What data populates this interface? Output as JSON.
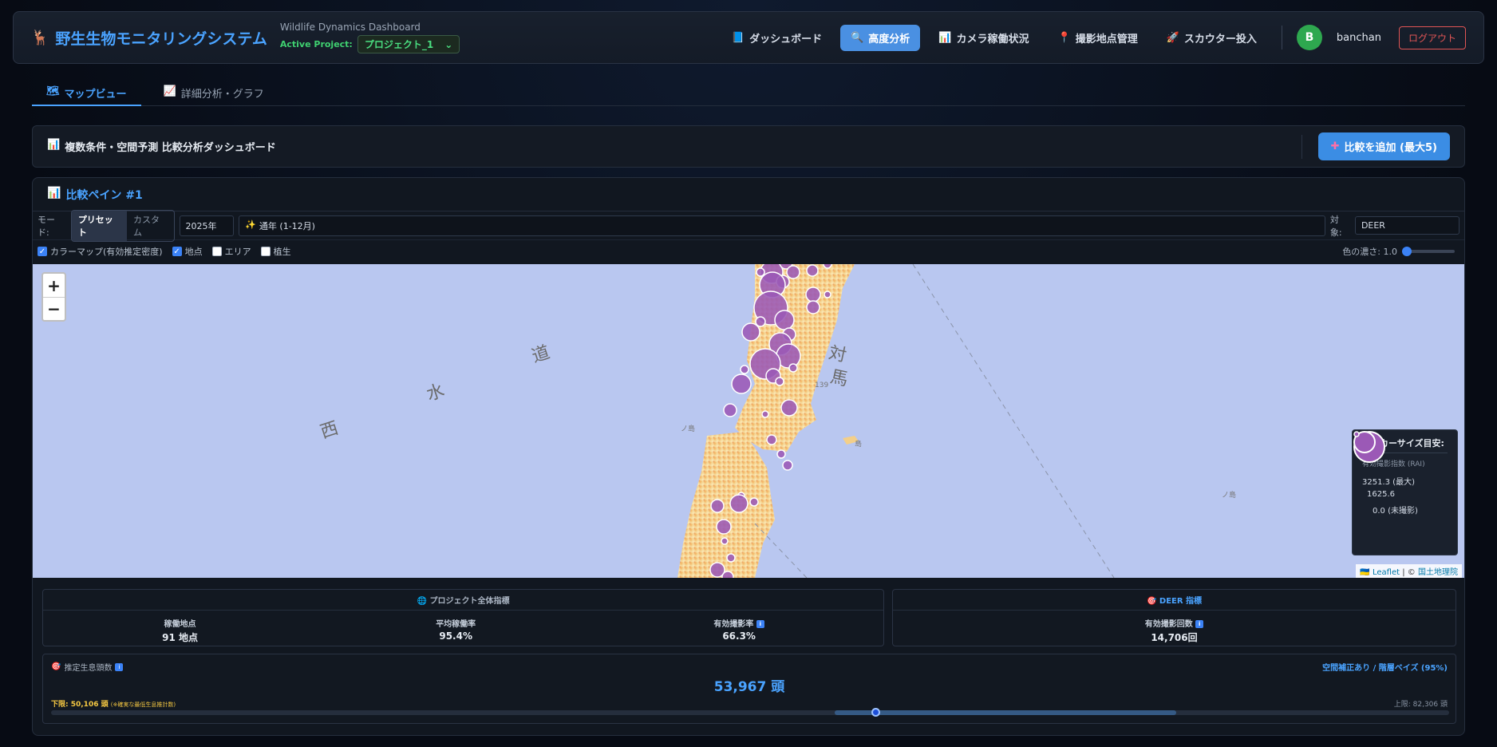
{
  "header": {
    "app_title": "野生生物モニタリングシステム",
    "subtitle": "Wildlife Dynamics Dashboard",
    "project_label": "Active Project:",
    "project_value": "プロジェクト_1",
    "nav": [
      {
        "label": "ダッシュボード",
        "icon": "book-icon"
      },
      {
        "label": "高度分析",
        "icon": "magnifier-icon",
        "active": true
      },
      {
        "label": "カメラ稼働状況",
        "icon": "bar-chart-icon"
      },
      {
        "label": "撮影地点管理",
        "icon": "pin-icon"
      },
      {
        "label": "スカウター投入",
        "icon": "rocket-icon"
      }
    ],
    "avatar_letter": "B",
    "username": "banchan",
    "logout_label": "ログアウト"
  },
  "tabs": [
    {
      "label": "マップビュー",
      "active": true
    },
    {
      "label": "詳細分析・グラフ"
    }
  ],
  "section": {
    "title": "複数条件・空間予測 比較分析ダッシュボード",
    "add_button": "比較を追加 (最大5)"
  },
  "pane": {
    "title": "比較ペイン #1",
    "mode_label": "モード:",
    "mode_preset": "プリセット",
    "mode_custom": "カスタム",
    "year": "2025年",
    "period": "通年 (1-12月)",
    "target_label": "対象:",
    "target_value": "DEER",
    "layers": {
      "colormap": "カラーマップ(有効推定密度)",
      "points": "地点",
      "area": "エリア",
      "vegetation": "植生"
    },
    "opacity_label": "色の濃さ: 1.0",
    "opacity": 1.0
  },
  "map": {
    "zoom_in": "+",
    "zoom_out": "−",
    "labels": {
      "do": "道",
      "sui": "水",
      "nishi": "西",
      "tsu": "対",
      "ma": "馬",
      "small_139": "139",
      "island_1": "ノ島",
      "island_2": "ノ島",
      "island_3": "島"
    },
    "legend": {
      "title": "マーカーサイズ目安:",
      "subtitle": "有効撮影指数 (RAI)",
      "max_label": "3251.3 (最大)",
      "mid_label": "1625.6",
      "zero_label": "0.0 (未撮影)"
    },
    "attribution_leaflet": "Leaflet",
    "attribution_sep": "| ©",
    "attribution_gsi": "国土地理院",
    "colors": {
      "sea": "#b9c7f0",
      "marker": "#9b59b6"
    }
  },
  "stats": {
    "project_head": "プロジェクト全体指標",
    "operating_label": "稼働地点",
    "operating_value": "91 地点",
    "avg_rate_label": "平均稼働率",
    "avg_rate_value": "95.4%",
    "valid_rate_label": "有効撮影率",
    "valid_rate_value": "66.3%",
    "species_head": "DEER 指標",
    "valid_count_label": "有効撮影回数",
    "valid_count_value": "14,706回"
  },
  "estimate": {
    "label": "推定生息頭数",
    "method": "空間補正あり / 階層ベイズ (95%)",
    "value": "53,967 頭",
    "lower": "下限: 50,106 頭",
    "lower_note": "(※確実な最低生息推計数)",
    "upper": "上限: 82,306 頭",
    "range_min": 0,
    "range_max": 82306,
    "lower_value": 50106,
    "point_value": 53967,
    "upper_value": 82306
  }
}
